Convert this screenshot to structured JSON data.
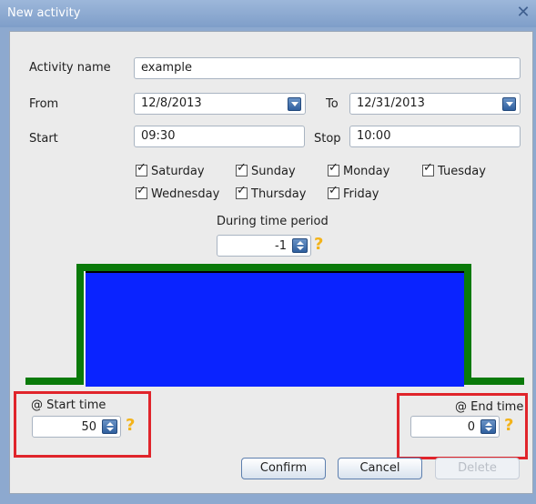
{
  "window": {
    "title": "New activity",
    "close_label": "✕"
  },
  "form": {
    "activity_name_label": "Activity name",
    "activity_name_value": "example",
    "from_label": "From",
    "from_value": "12/8/2013",
    "to_label": "To",
    "to_value": "12/31/2013",
    "start_label": "Start",
    "start_value": "09:30",
    "stop_label": "Stop",
    "stop_value": "10:00"
  },
  "days": [
    {
      "label": "Saturday",
      "checked": true
    },
    {
      "label": "Sunday",
      "checked": true
    },
    {
      "label": "Monday",
      "checked": true
    },
    {
      "label": "Tuesday",
      "checked": true
    },
    {
      "label": "Wednesday",
      "checked": true
    },
    {
      "label": "Thursday",
      "checked": true
    },
    {
      "label": "Friday",
      "checked": true
    }
  ],
  "period": {
    "label": "During time period",
    "value": "-1"
  },
  "diagram": {
    "fill_color": "#0a23ff",
    "top_color": "#000000",
    "line_color": "#0a7a0a"
  },
  "start_time": {
    "label": "@ Start time",
    "value": "50"
  },
  "end_time": {
    "label": "@ End time",
    "value": "0"
  },
  "buttons": {
    "confirm": "Confirm",
    "cancel": "Cancel",
    "delete": "Delete"
  }
}
